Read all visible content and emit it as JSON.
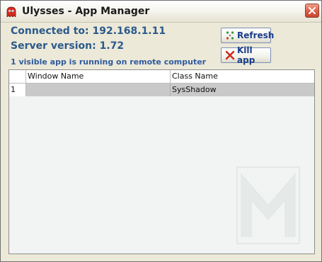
{
  "window": {
    "title": "Ulysses - App Manager"
  },
  "info": {
    "connected": "Connected to: 192.168.1.11",
    "server_version": "Server version: 1.72",
    "status": "1 visible app is running on remote computer"
  },
  "buttons": {
    "refresh": "Refresh",
    "kill": "Kill app"
  },
  "table": {
    "headers": {
      "index": "",
      "window_name": "Window Name",
      "class_name": "Class Name"
    },
    "rows": [
      {
        "index": "1",
        "window_name": "",
        "class_name": "SysShadow"
      }
    ]
  },
  "icons": {
    "app": "ghost-icon",
    "close": "close-icon",
    "refresh": "refresh-icon",
    "kill": "kill-x-icon",
    "watermark": "m-logo-watermark"
  },
  "colors": {
    "info_text": "#2b5a8c",
    "button_text": "#1a3e8a",
    "row_selected": "#c9c9c9",
    "close_button": "#e0614a"
  }
}
